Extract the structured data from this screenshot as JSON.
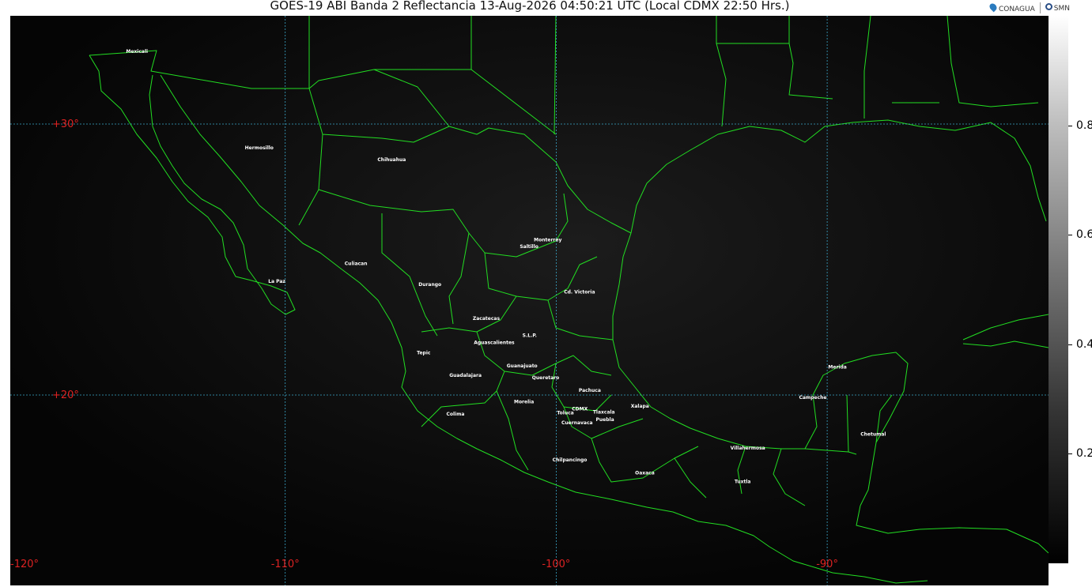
{
  "title": "GOES-19 ABI Banda 2 Reflectancia 13-Aug-2026 04:50:21 UTC (Local CDMX  22:50 Hrs.)",
  "logos": {
    "conagua": "CONAGUA",
    "smn": "SMN"
  },
  "icons": [
    "conagua-drop-icon",
    "smn-sun-icon"
  ],
  "colors": {
    "map_background": "#050505",
    "coastline": "#22dd22",
    "grid": "#3aa6c8",
    "grid_label": "#dd2222",
    "city_label": "#ffffff"
  },
  "grid": {
    "lat_labels": [
      "+30°",
      "+20°"
    ],
    "lon_labels": [
      "-120°",
      "-110°",
      "-100°",
      "-90°"
    ]
  },
  "colorbar": {
    "range": [
      0,
      1
    ],
    "ticks": [
      "0.8",
      "0.6",
      "0.4",
      "0.2"
    ]
  },
  "cities": [
    {
      "name": "Mexicali",
      "lon": -115.47,
      "lat": 32.62
    },
    {
      "name": "Hermosillo",
      "lon": -110.96,
      "lat": 29.07
    },
    {
      "name": "Chihuahua",
      "lon": -106.07,
      "lat": 28.63
    },
    {
      "name": "Monterrey",
      "lon": -100.31,
      "lat": 25.67
    },
    {
      "name": "Saltillo",
      "lon": -101.0,
      "lat": 25.43
    },
    {
      "name": "Culiacan",
      "lon": -107.39,
      "lat": 24.8
    },
    {
      "name": "La Paz",
      "lon": -110.31,
      "lat": 24.14
    },
    {
      "name": "Durango",
      "lon": -104.66,
      "lat": 24.02
    },
    {
      "name": "Cd. Victoria",
      "lon": -99.14,
      "lat": 23.74
    },
    {
      "name": "Zacatecas",
      "lon": -102.58,
      "lat": 22.77
    },
    {
      "name": "S.L.P.",
      "lon": -100.98,
      "lat": 22.15
    },
    {
      "name": "Aguascalientes",
      "lon": -102.29,
      "lat": 21.88
    },
    {
      "name": "Tepic",
      "lon": -104.89,
      "lat": 21.5
    },
    {
      "name": "Guanajuato",
      "lon": -101.26,
      "lat": 21.02
    },
    {
      "name": "Guadalajara",
      "lon": -103.35,
      "lat": 20.67
    },
    {
      "name": "Queretaro",
      "lon": -100.39,
      "lat": 20.59
    },
    {
      "name": "Merida",
      "lon": -89.62,
      "lat": 20.97
    },
    {
      "name": "Pachuca",
      "lon": -98.76,
      "lat": 20.12
    },
    {
      "name": "Campeche",
      "lon": -90.53,
      "lat": 19.85
    },
    {
      "name": "Morelia",
      "lon": -101.19,
      "lat": 19.7
    },
    {
      "name": "Xalapa",
      "lon": -96.91,
      "lat": 19.53
    },
    {
      "name": "Colima",
      "lon": -103.72,
      "lat": 19.24
    },
    {
      "name": "Toluca",
      "lon": -99.66,
      "lat": 19.28
    },
    {
      "name": "CDMX",
      "lon": -99.13,
      "lat": 19.43
    },
    {
      "name": "Tlaxcala",
      "lon": -98.24,
      "lat": 19.31
    },
    {
      "name": "Puebla",
      "lon": -98.2,
      "lat": 19.04
    },
    {
      "name": "Cuernavaca",
      "lon": -99.23,
      "lat": 18.92
    },
    {
      "name": "Chetumal",
      "lon": -88.3,
      "lat": 18.5
    },
    {
      "name": "Villahermosa",
      "lon": -92.93,
      "lat": 17.99
    },
    {
      "name": "Chilpancingo",
      "lon": -99.5,
      "lat": 17.55
    },
    {
      "name": "Oaxaca",
      "lon": -96.73,
      "lat": 17.07
    },
    {
      "name": "Tuxtla",
      "lon": -93.12,
      "lat": 16.75
    }
  ]
}
